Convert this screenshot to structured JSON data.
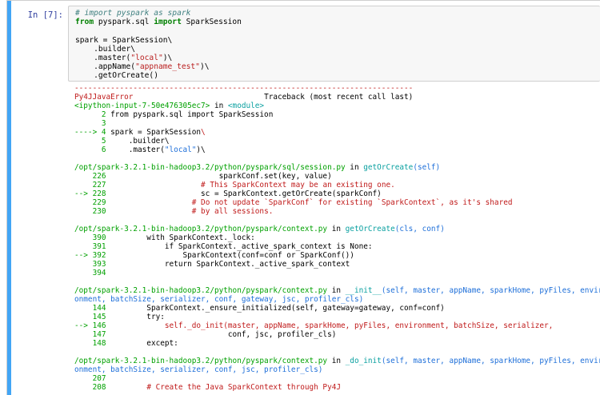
{
  "cell": {
    "prompt": "In [7]:"
  },
  "input_lines": [
    [
      {
        "t": "# import pyspark as spark",
        "c": "cm"
      }
    ],
    [
      {
        "t": "from",
        "c": "kw"
      },
      {
        "t": " pyspark.sql ",
        "c": ""
      },
      {
        "t": "import",
        "c": "kw"
      },
      {
        "t": " SparkSession",
        "c": ""
      }
    ],
    [
      {
        "t": "",
        "c": ""
      }
    ],
    [
      {
        "t": "spark = SparkSession\\",
        "c": ""
      }
    ],
    [
      {
        "t": "    .builder\\",
        "c": ""
      }
    ],
    [
      {
        "t": "    .master(",
        "c": ""
      },
      {
        "t": "\"local\"",
        "c": "st"
      },
      {
        "t": ")\\",
        "c": ""
      }
    ],
    [
      {
        "t": "    .appName(",
        "c": ""
      },
      {
        "t": "\"appname_test\"",
        "c": "st"
      },
      {
        "t": ")\\",
        "c": ""
      }
    ],
    [
      {
        "t": "    .getOrCreate()",
        "c": ""
      }
    ]
  ],
  "output_lines": [
    [
      {
        "t": "---------------------------------------------------------------------------",
        "c": "red"
      }
    ],
    [
      {
        "t": "Py4JJavaError                             ",
        "c": "red"
      },
      {
        "t": "Traceback (most recent call last)",
        "c": ""
      }
    ],
    [
      {
        "t": "<ipython-input-7-50e476305ec7>",
        "c": "grn"
      },
      {
        "t": " in ",
        "c": ""
      },
      {
        "t": "<module>",
        "c": "cyn"
      }
    ],
    [
      {
        "t": "      2 ",
        "c": "grn"
      },
      {
        "t": "from pyspark.sql import SparkSession",
        "c": ""
      }
    ],
    [
      {
        "t": "      3 ",
        "c": "grn"
      }
    ],
    [
      {
        "t": "----> 4 ",
        "c": "grn"
      },
      {
        "t": "spark = SparkSession",
        "c": ""
      },
      {
        "t": "\\",
        "c": "red"
      }
    ],
    [
      {
        "t": "      5 ",
        "c": "grn"
      },
      {
        "t": "    .builder\\",
        "c": ""
      }
    ],
    [
      {
        "t": "      6 ",
        "c": "grn"
      },
      {
        "t": "    .master(",
        "c": ""
      },
      {
        "t": "\"local\"",
        "c": "blu"
      },
      {
        "t": ")\\",
        "c": ""
      }
    ],
    [],
    [
      {
        "t": "/opt/spark-3.2.1-bin-hadoop3.2/python/pyspark/sql/session.py",
        "c": "grn"
      },
      {
        "t": " in ",
        "c": ""
      },
      {
        "t": "getOrCreate",
        "c": "cyn"
      },
      {
        "t": "(self)",
        "c": "blu"
      }
    ],
    [
      {
        "t": "    226 ",
        "c": "grn"
      },
      {
        "t": "                        sparkConf.set(key, value)",
        "c": ""
      }
    ],
    [
      {
        "t": "    227 ",
        "c": "grn"
      },
      {
        "t": "                    ",
        "c": ""
      },
      {
        "t": "# This SparkContext may be an existing one.",
        "c": "red"
      }
    ],
    [
      {
        "t": "--> 228 ",
        "c": "grn"
      },
      {
        "t": "                    sc = SparkContext.getOrCreate(sparkConf)",
        "c": ""
      }
    ],
    [
      {
        "t": "    229 ",
        "c": "grn"
      },
      {
        "t": "                  ",
        "c": ""
      },
      {
        "t": "# Do not update `SparkConf` for existing `SparkContext`, as it's shared",
        "c": "red"
      }
    ],
    [
      {
        "t": "    230 ",
        "c": "grn"
      },
      {
        "t": "                  ",
        "c": ""
      },
      {
        "t": "# by all sessions.",
        "c": "red"
      }
    ],
    [],
    [
      {
        "t": "/opt/spark-3.2.1-bin-hadoop3.2/python/pyspark/context.py",
        "c": "grn"
      },
      {
        "t": " in ",
        "c": ""
      },
      {
        "t": "getOrCreate",
        "c": "cyn"
      },
      {
        "t": "(cls, conf)",
        "c": "blu"
      }
    ],
    [
      {
        "t": "    390 ",
        "c": "grn"
      },
      {
        "t": "        with SparkContext._lock:",
        "c": ""
      }
    ],
    [
      {
        "t": "    391 ",
        "c": "grn"
      },
      {
        "t": "            if SparkContext._active_spark_context is None:",
        "c": ""
      }
    ],
    [
      {
        "t": "--> 392 ",
        "c": "grn"
      },
      {
        "t": "                SparkContext(conf=conf or SparkConf())",
        "c": ""
      }
    ],
    [
      {
        "t": "    393 ",
        "c": "grn"
      },
      {
        "t": "            return SparkContext._active_spark_context",
        "c": ""
      }
    ],
    [
      {
        "t": "    394 ",
        "c": "grn"
      }
    ],
    [],
    [
      {
        "t": "/opt/spark-3.2.1-bin-hadoop3.2/python/pyspark/context.py",
        "c": "grn"
      },
      {
        "t": " in ",
        "c": ""
      },
      {
        "t": "__init__",
        "c": "cyn"
      },
      {
        "t": "(self, master, appName, sparkHome, pyFiles, envir",
        "c": "blu"
      }
    ],
    [
      {
        "t": "onment, batchSize, serializer, conf, gateway, jsc, profiler_cls)",
        "c": "blu"
      }
    ],
    [
      {
        "t": "    144 ",
        "c": "grn"
      },
      {
        "t": "        SparkContext._ensure_initialized(self, gateway=gateway, conf=conf)",
        "c": ""
      }
    ],
    [
      {
        "t": "    145 ",
        "c": "grn"
      },
      {
        "t": "        try:",
        "c": ""
      }
    ],
    [
      {
        "t": "--> 146 ",
        "c": "grn"
      },
      {
        "t": "            self._do_init(master, appName, sparkHome, pyFiles, environment, batchSize, serializer,",
        "c": "red"
      }
    ],
    [
      {
        "t": "    147 ",
        "c": "grn"
      },
      {
        "t": "                          conf, jsc, profiler_cls)",
        "c": ""
      }
    ],
    [
      {
        "t": "    148 ",
        "c": "grn"
      },
      {
        "t": "        except:",
        "c": ""
      }
    ],
    [],
    [
      {
        "t": "/opt/spark-3.2.1-bin-hadoop3.2/python/pyspark/context.py",
        "c": "grn"
      },
      {
        "t": " in ",
        "c": ""
      },
      {
        "t": "_do_init",
        "c": "cyn"
      },
      {
        "t": "(self, master, appName, sparkHome, pyFiles, envir",
        "c": "blu"
      }
    ],
    [
      {
        "t": "onment, batchSize, serializer, conf, jsc, profiler_cls)",
        "c": "blu"
      }
    ],
    [
      {
        "t": "    207 ",
        "c": "grn"
      }
    ],
    [
      {
        "t": "    208 ",
        "c": "grn"
      },
      {
        "t": "        ",
        "c": ""
      },
      {
        "t": "# Create the Java SparkContext through Py4J",
        "c": "red"
      }
    ]
  ]
}
